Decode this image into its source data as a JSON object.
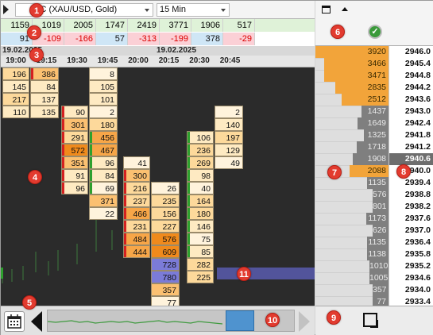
{
  "toolbar": {
    "symbol": "GC (XAU/USD, Gold)",
    "timeframe": "15 Min"
  },
  "stats": {
    "row1": [
      "1159",
      "1019",
      "2005",
      "1747",
      "2419",
      "3771",
      "1906",
      "517"
    ],
    "row2": [
      {
        "v": "91",
        "neg": false
      },
      {
        "v": "-109",
        "neg": true
      },
      {
        "v": "-166",
        "neg": true
      },
      {
        "v": "57",
        "neg": false
      },
      {
        "v": "-313",
        "neg": true
      },
      {
        "v": "-199",
        "neg": true
      },
      {
        "v": "378",
        "neg": false
      },
      {
        "v": "-29",
        "neg": true
      }
    ]
  },
  "dates": {
    "left": "19.02.2025",
    "mid": "19.02.2025"
  },
  "times": [
    "19:00",
    "19:15",
    "19:30",
    "19:45",
    "20:00",
    "20:15",
    "20:30",
    "20:45"
  ],
  "footprint": {
    "c0": [
      [
        "196",
        "386"
      ],
      [
        "145",
        "84"
      ],
      [
        "217",
        "137"
      ],
      [
        "110",
        "135"
      ]
    ],
    "c2": [
      [
        "",
        "8"
      ],
      [
        "",
        "105"
      ],
      [
        "",
        "101"
      ],
      [
        "90",
        "2"
      ],
      [
        "301",
        "180"
      ],
      [
        "291",
        "456"
      ],
      [
        "572",
        "467"
      ],
      [
        "351",
        "96"
      ],
      [
        "91",
        "84"
      ],
      [
        "96",
        "69"
      ],
      [
        "",
        "371"
      ],
      [
        "",
        "22"
      ]
    ],
    "c4": [
      [
        "41",
        "",
        ""
      ],
      [
        "300",
        ""
      ],
      [
        "216",
        "26"
      ],
      [
        "237",
        "235"
      ],
      [
        "466",
        "156"
      ],
      [
        "231",
        "227"
      ],
      [
        "484",
        "576"
      ],
      [
        "444",
        "609"
      ],
      [
        "",
        "728"
      ],
      [
        "",
        "780"
      ],
      [
        "",
        "357"
      ],
      [
        "",
        "77"
      ]
    ],
    "c6": [
      [
        "",
        "2"
      ],
      [
        "",
        "140"
      ],
      [
        "106",
        "197"
      ],
      [
        "236",
        "129"
      ],
      [
        "269",
        "49"
      ],
      [
        "98",
        ""
      ],
      [
        "40",
        ""
      ],
      [
        "164",
        ""
      ],
      [
        "180",
        ""
      ],
      [
        "146",
        ""
      ],
      [
        "75",
        ""
      ],
      [
        "85",
        ""
      ],
      [
        "282",
        ""
      ],
      [
        "225",
        ""
      ]
    ]
  },
  "ladder": [
    {
      "vol": "3920",
      "price": "2946.0"
    },
    {
      "vol": "3466",
      "price": "2945.4"
    },
    {
      "vol": "3471",
      "price": "2944.8"
    },
    {
      "vol": "2835",
      "price": "2944.2"
    },
    {
      "vol": "2512",
      "price": "2943.6"
    },
    {
      "vol": "1437",
      "price": "2943.0"
    },
    {
      "vol": "1649",
      "price": "2942.4"
    },
    {
      "vol": "1325",
      "price": "2941.8"
    },
    {
      "vol": "1718",
      "price": "2941.2"
    },
    {
      "vol": "1908",
      "price": "2940.6"
    },
    {
      "vol": "2088",
      "price": "2940.0"
    },
    {
      "vol": "1135",
      "price": "2939.4"
    },
    {
      "vol": "576",
      "price": "2938.8"
    },
    {
      "vol": "801",
      "price": "2938.2"
    },
    {
      "vol": "1173",
      "price": "2937.6"
    },
    {
      "vol": "626",
      "price": "2937.0"
    },
    {
      "vol": "1135",
      "price": "2936.4"
    },
    {
      "vol": "1138",
      "price": "2935.8"
    },
    {
      "vol": "1010",
      "price": "2935.2"
    },
    {
      "vol": "1005",
      "price": "2934.6"
    },
    {
      "vol": "357",
      "price": "2934.0"
    },
    {
      "vol": "77",
      "price": "2933.4"
    }
  ],
  "badges": [
    "1",
    "2",
    "3",
    "4",
    "5",
    "6",
    "7",
    "8",
    "9",
    "10",
    "11"
  ],
  "colors": {
    "accent_orange": "#f2a43a",
    "volume_bar": "#7f7f7f",
    "highlight_blue": "#5659a7",
    "positive_bg": "#cfe6f6",
    "negative_bg": "#fbd0d6"
  }
}
